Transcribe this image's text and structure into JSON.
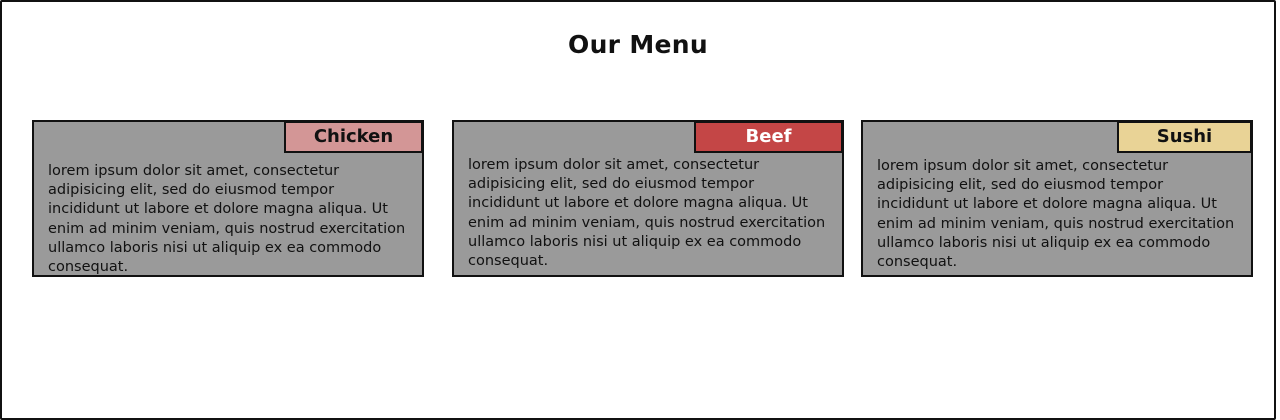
{
  "page": {
    "title": "Our Menu"
  },
  "theme": {
    "card_bg": "#9a9a9a",
    "text_color": "#111111"
  },
  "cards": [
    {
      "tag": "Chicken",
      "tag_bg": "#d39696",
      "tag_color": "#111111",
      "text": "lorem ipsum dolor sit amet, consectetur adipisicing elit, sed do eiusmod tempor incididunt ut labore et dolore magna aliqua. Ut enim ad minim veniam, quis nostrud exercitation ullamco laboris nisi ut aliquip ex ea commodo consequat."
    },
    {
      "tag": "Beef",
      "tag_bg": "#c44646",
      "tag_color": "#ffffff",
      "text": "lorem ipsum dolor sit amet, consectetur adipisicing elit, sed do eiusmod tempor incididunt ut labore et dolore magna aliqua. Ut enim ad minim veniam, quis nostrud exercitation ullamco laboris nisi ut aliquip ex ea commodo consequat."
    },
    {
      "tag": "Sushi",
      "tag_bg": "#e9d396",
      "tag_color": "#111111",
      "text": "lorem ipsum dolor sit amet, consectetur adipisicing elit, sed do eiusmod tempor incididunt ut labore et dolore magna aliqua. Ut enim ad minim veniam, quis nostrud exercitation ullamco laboris nisi ut aliquip ex ea commodo consequat."
    }
  ]
}
